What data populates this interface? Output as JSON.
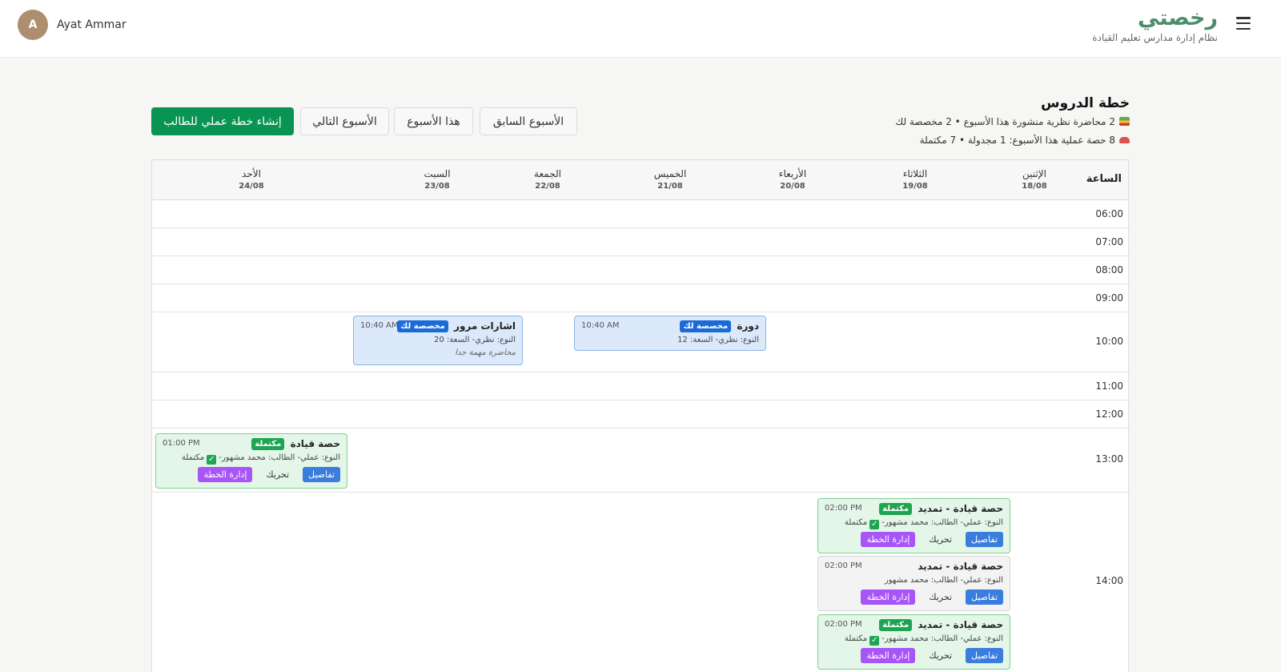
{
  "header": {
    "brand_title": "رخصتي",
    "brand_subtitle": "نظام إدارة مدارس تعليم القيادة",
    "user_initial": "A",
    "user_name": "Ayat Ammar"
  },
  "plan": {
    "title": "خطة الدروس",
    "summary_theory": "2 محاضرة نظرية منشورة هذا الأسبوع • 2 مخصصة لك",
    "summary_practical": "8 حصة عملية هذا الأسبوع: 1 مجدولة • 7 مكتملة",
    "buttons": {
      "prev_week": "الأسبوع السابق",
      "this_week": "هذا الأسبوع",
      "next_week": "الأسبوع التالي",
      "create_plan": "إنشاء خطة عملي للطالب"
    }
  },
  "calendar": {
    "time_label": "الساعة",
    "days": [
      {
        "name": "الإثنين",
        "date": "18/08"
      },
      {
        "name": "الثلاثاء",
        "date": "19/08"
      },
      {
        "name": "الأربعاء",
        "date": "20/08"
      },
      {
        "name": "الخميس",
        "date": "21/08"
      },
      {
        "name": "الجمعة",
        "date": "22/08"
      },
      {
        "name": "السبت",
        "date": "23/08"
      },
      {
        "name": "الأحد",
        "date": "24/08"
      }
    ],
    "times": [
      "06:00",
      "07:00",
      "08:00",
      "09:00",
      "10:00",
      "11:00",
      "12:00",
      "13:00",
      "14:00"
    ],
    "events": [
      {
        "title": "دورة",
        "badge": "مخصصة لك",
        "time": "10:40 AM",
        "info": "النوع: نظري- السعة: 12"
      },
      {
        "title": "اشارات مرور",
        "badge": "مخصصة لك",
        "time": "10:40 AM",
        "info": "النوع: نظري- السعة: 20",
        "note": "محاضرة مهمة جدا"
      },
      {
        "title": "حصة قيادة",
        "badge": "مكتملة",
        "time": "01:00 PM",
        "info": "النوع: عملي- الطالب: محمد مشهور-",
        "status": "مكتملة",
        "actions": {
          "details": "تفاصيل",
          "move": "تحريك",
          "plan": "إدارة الخطة"
        }
      },
      {
        "title": "حصة قيادة - تمديد",
        "badge": "مكتملة",
        "time": "02:00 PM",
        "info": "النوع: عملي- الطالب: محمد مشهور-",
        "status": "مكتملة",
        "actions": {
          "details": "تفاصيل",
          "move": "تحريك",
          "plan": "إدارة الخطة"
        }
      },
      {
        "title": "حصة قيادة - تمديد",
        "time": "02:00 PM",
        "info": "النوع: عملي- الطالب: محمد مشهور",
        "actions": {
          "details": "تفاصيل",
          "move": "تحريك",
          "plan": "إدارة الخطة"
        }
      },
      {
        "title": "حصة قيادة - تمديد",
        "badge": "مكتملة",
        "time": "02:00 PM",
        "info": "النوع: عملي- الطالب: محمد مشهور-",
        "status": "مكتملة",
        "actions": {
          "details": "تفاصيل",
          "move": "تحريك",
          "plan": "إدارة الخطة"
        }
      }
    ]
  },
  "colors": {
    "brand": "#4a8d68",
    "primary_button": "#0a9454",
    "assigned_badge": "#1a6ad7",
    "completed_badge": "#1fa451",
    "details_button": "#3b7ddd",
    "plan_button": "#a855f7"
  },
  "icons": {
    "menu": "hamburger-icon",
    "theory": "books-icon",
    "practical": "car-icon",
    "completed": "checkbox-checked-icon"
  }
}
